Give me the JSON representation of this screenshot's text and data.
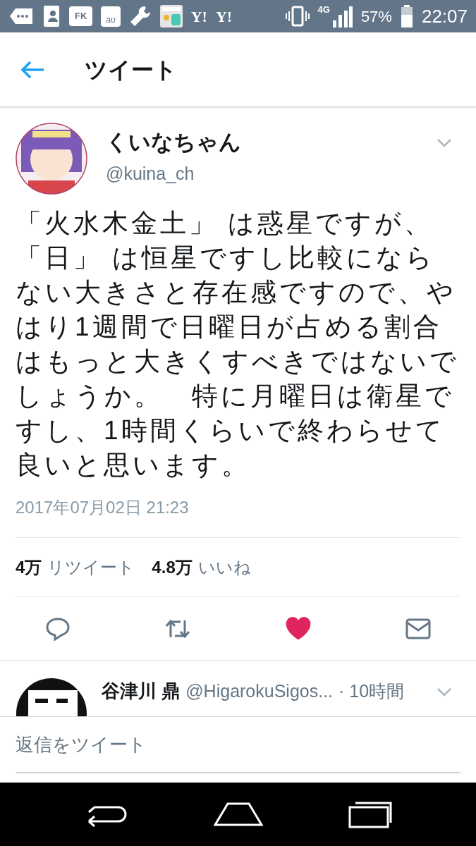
{
  "status_bar": {
    "notifications": [
      {
        "kind": "dots"
      },
      {
        "kind": "contacts"
      },
      {
        "kind": "folder",
        "label": "FK"
      },
      {
        "kind": "mail",
        "label": "au"
      },
      {
        "kind": "wrench"
      },
      {
        "kind": "news"
      },
      {
        "kind": "text",
        "label": "Y!"
      },
      {
        "kind": "text",
        "label": "Y!"
      }
    ],
    "network": "4G",
    "battery": "57%",
    "time": "22:07"
  },
  "header": {
    "title": "ツイート"
  },
  "tweet": {
    "name": "くいなちゃん",
    "handle": "@kuina_ch",
    "text": [
      "「火水木金土」 は惑星ですが、",
      "「日」 は恒星ですし比較にならない大きさと存在感ですので、やはり1週間で日曜日が占める割合はもっと大きくすべきではないでしょうか。　特に月曜日は衛星ですし、1時間くらいで終わらせて良いと思います。"
    ],
    "timestamp": "2017年07月02日 21:23",
    "stats": [
      {
        "count": "4万",
        "label": "リツイート"
      },
      {
        "count": "4.8万",
        "label": "いいね"
      }
    ],
    "actions": [
      {
        "kind": "reply",
        "selected": false
      },
      {
        "kind": "retweet",
        "selected": false
      },
      {
        "kind": "like",
        "selected": true
      },
      {
        "kind": "message",
        "selected": false
      }
    ]
  },
  "reply": {
    "name": "谷津川 鼎",
    "handle": "@HigarokuSigos...",
    "time": "· 10時間"
  },
  "composer": {
    "placeholder": "返信をツイート"
  }
}
